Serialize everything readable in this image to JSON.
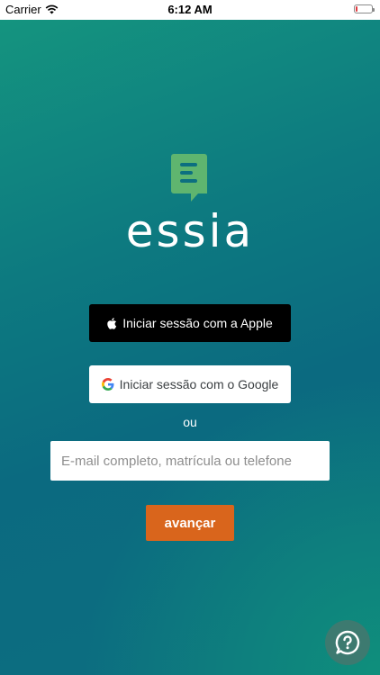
{
  "status_bar": {
    "carrier": "Carrier",
    "time": "6:12 AM",
    "battery_level": 0.1
  },
  "brand": {
    "name": "essia",
    "icon": "chat-document-icon",
    "icon_color": "#5fb56f"
  },
  "login": {
    "apple_label": "Iniciar sessão com a Apple",
    "google_label": "Iniciar sessão com o Google",
    "or_label": "ou",
    "input_placeholder": "E-mail completo, matrícula ou telefone",
    "input_value": "",
    "next_label": "avançar"
  },
  "help": {
    "icon": "question-chat-icon"
  },
  "colors": {
    "accent": "#d9651c",
    "background_top": "#15967f",
    "background_mid": "#0b6a80"
  }
}
